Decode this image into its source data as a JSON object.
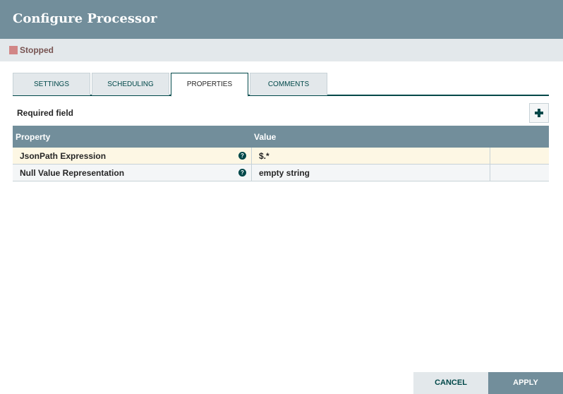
{
  "dialog": {
    "title": "Configure Processor"
  },
  "status": {
    "label": "Stopped",
    "color": "#d18686"
  },
  "tabs": [
    {
      "label": "SETTINGS",
      "active": false
    },
    {
      "label": "SCHEDULING",
      "active": false
    },
    {
      "label": "PROPERTIES",
      "active": true
    },
    {
      "label": "COMMENTS",
      "active": false
    }
  ],
  "properties": {
    "required_label": "Required field",
    "add_icon": "plus-icon",
    "columns": {
      "property": "Property",
      "value": "Value"
    },
    "rows": [
      {
        "name": "JsonPath Expression",
        "value": "$.*",
        "help_icon": "question-circle-icon"
      },
      {
        "name": "Null Value Representation",
        "value": "empty string",
        "help_icon": "question-circle-icon"
      }
    ]
  },
  "footer": {
    "cancel_label": "CANCEL",
    "apply_label": "APPLY"
  }
}
